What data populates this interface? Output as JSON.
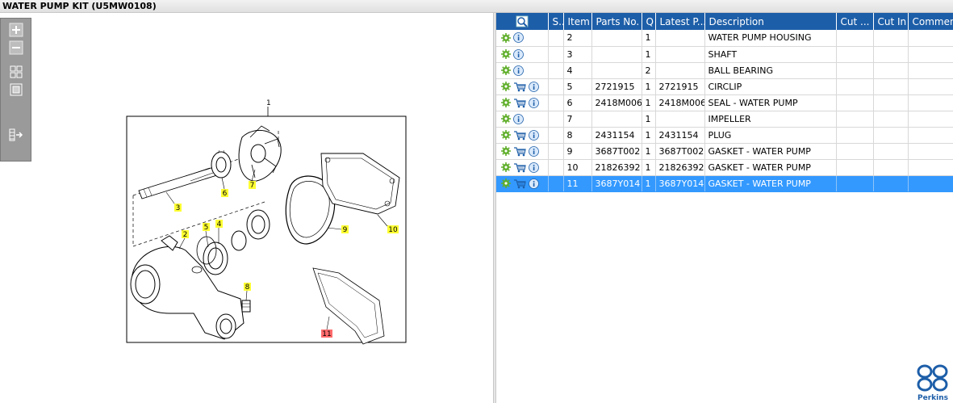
{
  "window": {
    "title": "WATER PUMP KIT (U5MW0108)"
  },
  "toolbar": {
    "icons": [
      "zoom-in-icon",
      "zoom-out-icon",
      "fit-icon",
      "actual-size-icon",
      "export-icon"
    ]
  },
  "diagram": {
    "label_main": "1",
    "callouts": [
      "2",
      "3",
      "4",
      "5",
      "6",
      "7",
      "8",
      "9",
      "10",
      "11"
    ]
  },
  "table": {
    "headers": [
      "",
      "S..",
      "Item",
      "Parts No.",
      "Q",
      "Latest P...",
      "Description",
      "Cut ...",
      "Cut In",
      "Comment"
    ],
    "rows": [
      {
        "item": "2",
        "parts_no": "",
        "qty": "1",
        "latest": "",
        "desc": "WATER PUMP HOUSING",
        "cart": false
      },
      {
        "item": "3",
        "parts_no": "",
        "qty": "1",
        "latest": "",
        "desc": "SHAFT",
        "cart": false
      },
      {
        "item": "4",
        "parts_no": "",
        "qty": "2",
        "latest": "",
        "desc": "BALL BEARING",
        "cart": false
      },
      {
        "item": "5",
        "parts_no": "2721915",
        "qty": "1",
        "latest": "2721915",
        "desc": "CIRCLIP",
        "cart": true
      },
      {
        "item": "6",
        "parts_no": "2418M006",
        "qty": "1",
        "latest": "2418M006",
        "desc": "SEAL - WATER PUMP",
        "cart": true
      },
      {
        "item": "7",
        "parts_no": "",
        "qty": "1",
        "latest": "",
        "desc": "IMPELLER",
        "cart": false
      },
      {
        "item": "8",
        "parts_no": "2431154",
        "qty": "1",
        "latest": "2431154",
        "desc": "PLUG",
        "cart": true
      },
      {
        "item": "9",
        "parts_no": "3687T002",
        "qty": "1",
        "latest": "3687T002",
        "desc": "GASKET - WATER PUMP",
        "cart": true
      },
      {
        "item": "10",
        "parts_no": "21826392",
        "qty": "1",
        "latest": "21826392",
        "desc": "GASKET - WATER PUMP",
        "cart": true
      },
      {
        "item": "11",
        "parts_no": "3687Y014",
        "qty": "1",
        "latest": "3687Y014",
        "desc": "GASKET - WATER PUMP",
        "cart": true,
        "selected": true
      }
    ]
  },
  "brand": {
    "name": "Perkins",
    "color": "#1d5ea8"
  },
  "colors": {
    "header_bg": "#1d5ea8",
    "selected_row": "#3399ff",
    "callout_yellow": "#ffff33",
    "callout_red": "#ff6b6b"
  }
}
